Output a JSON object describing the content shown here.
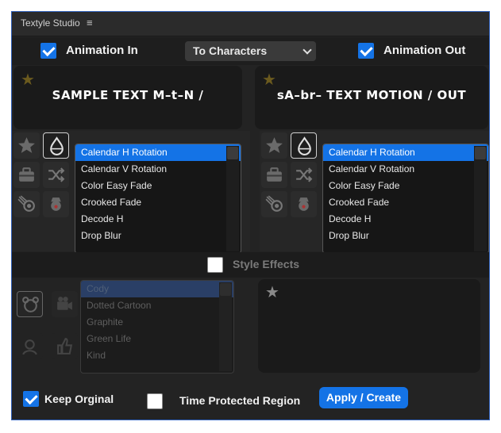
{
  "window": {
    "title": "Textyle Studio",
    "menu_glyph": "≡"
  },
  "top": {
    "animation_in": {
      "label": "Animation In",
      "checked": true
    },
    "mode_select": {
      "value": "To Characters"
    },
    "animation_out": {
      "label": "Animation Out",
      "checked": true
    }
  },
  "preview_in": {
    "text": "SAMPLE TEXT M–t–N /",
    "star": "★"
  },
  "preview_out": {
    "text": "sA–br– TEXT MOTION / OUT",
    "star": "★"
  },
  "in_list": {
    "items": [
      "Calendar H Rotation",
      "Calendar V Rotation",
      "Color Easy Fade",
      "Crooked Fade",
      "Decode H",
      "Drop Blur"
    ],
    "selected_index": 0
  },
  "out_list": {
    "items": [
      "Calendar H Rotation",
      "Calendar V Rotation",
      "Color Easy Fade",
      "Crooked Fade",
      "Decode H",
      "Drop Blur"
    ],
    "selected_index": 0
  },
  "style_effects": {
    "label": "Style Effects",
    "checked": false,
    "items": [
      "Cody",
      "Dotted Cartoon",
      "Graphite",
      "Green Life",
      "Kind"
    ],
    "selected_index": 0,
    "star": "★"
  },
  "footer": {
    "keep_original": {
      "label": "Keep Orginal",
      "checked": true
    },
    "time_protected": {
      "label": "Time Protected Region",
      "checked": false
    },
    "apply_label": "Apply / Create"
  },
  "colors": {
    "accent": "#1473e6",
    "panel": "#232323",
    "border": "#2f5fb8"
  }
}
